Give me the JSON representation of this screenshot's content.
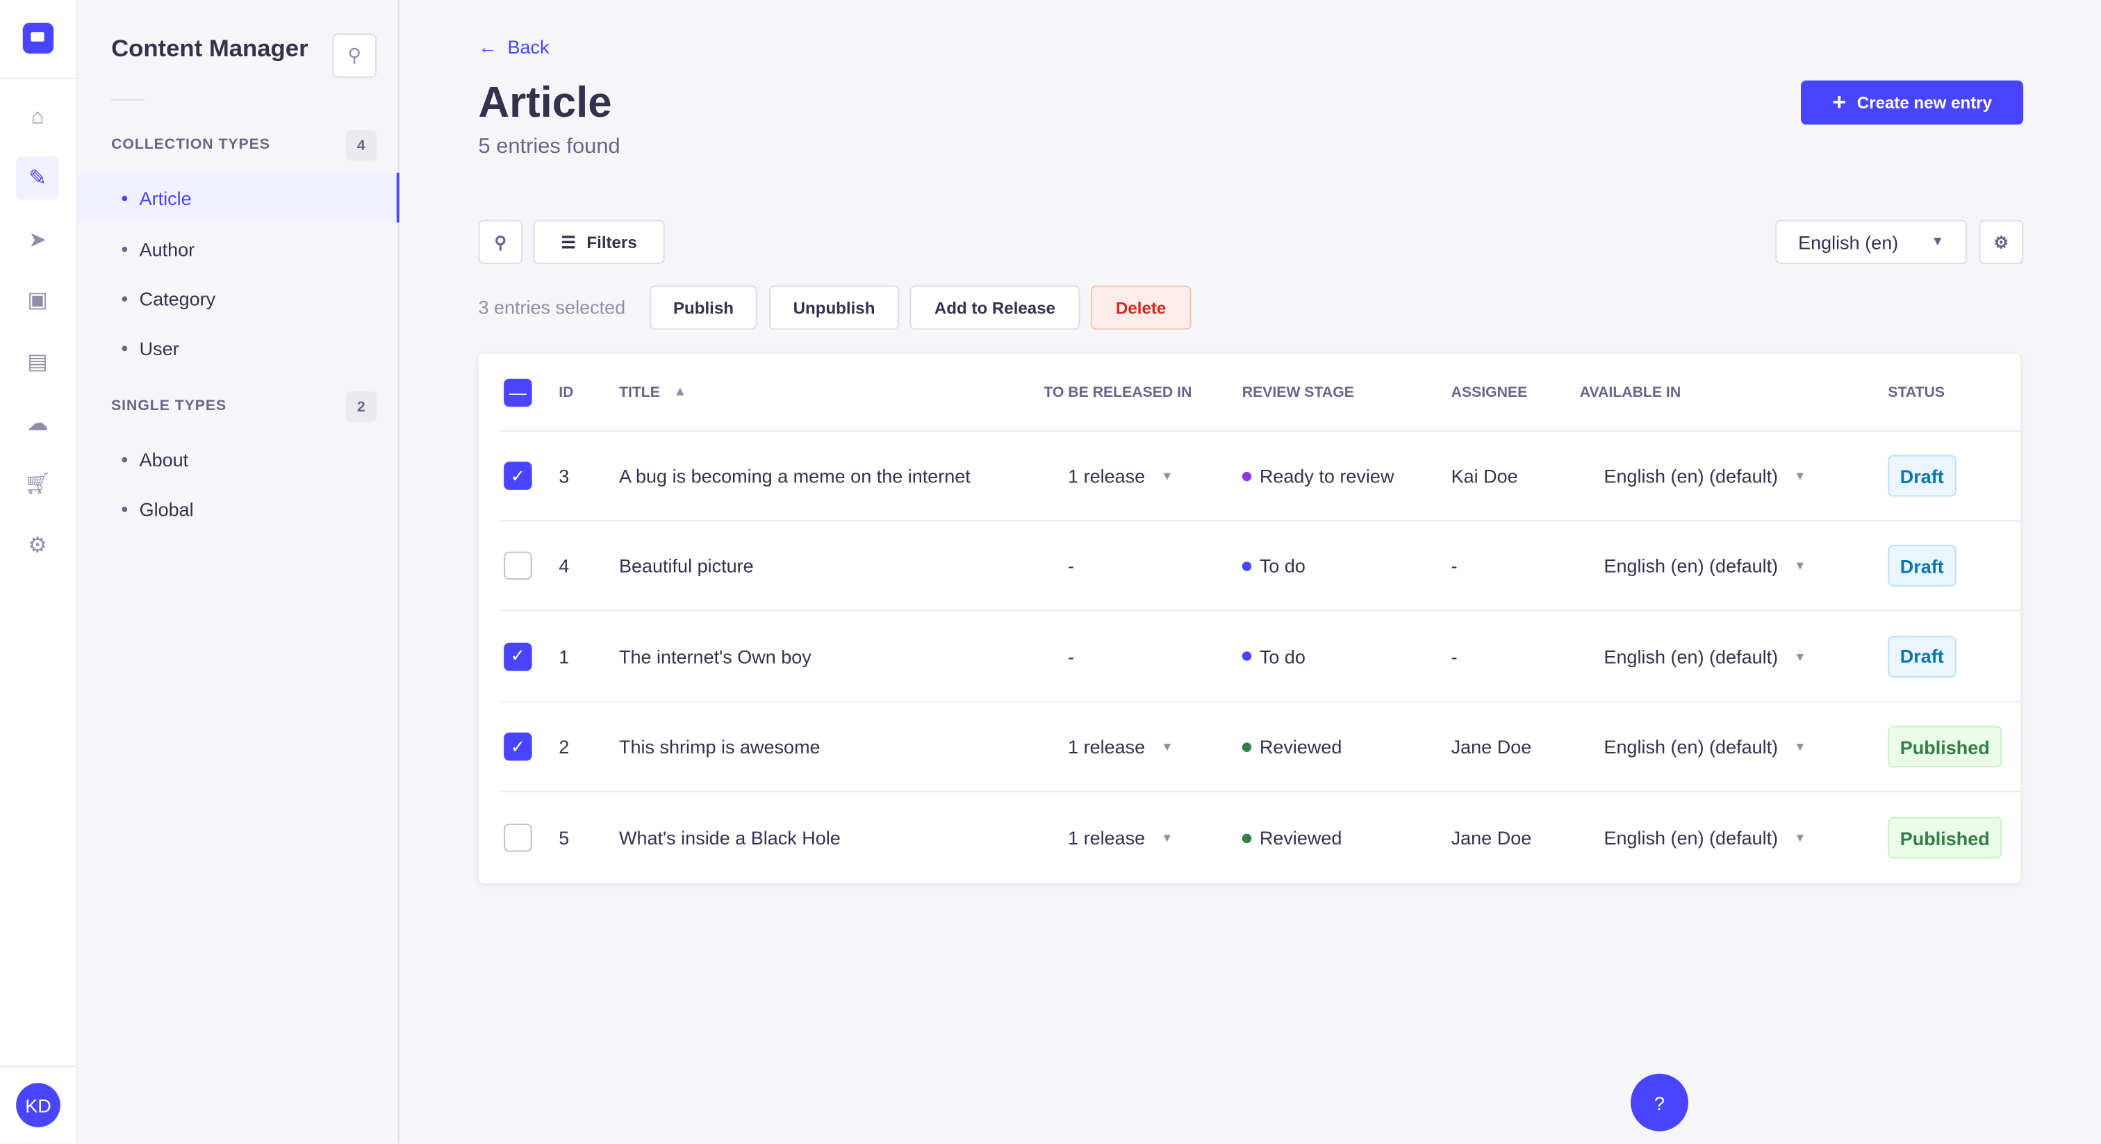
{
  "nav": {
    "avatar": "KD",
    "items": [
      "home-icon",
      "content-manager-icon",
      "releases-icon",
      "media-library-icon",
      "content-type-builder-icon",
      "cloud-icon",
      "marketplace-icon",
      "settings-icon"
    ]
  },
  "sidebar": {
    "title": "Content Manager",
    "collection_label": "COLLECTION TYPES",
    "collection_count": "4",
    "collection_items": [
      "Article",
      "Author",
      "Category",
      "User"
    ],
    "single_label": "SINGLE TYPES",
    "single_count": "2",
    "single_items": [
      "About",
      "Global"
    ]
  },
  "header": {
    "back": "Back",
    "title": "Article",
    "subtitle": "5 entries found",
    "create": "Create new entry"
  },
  "toolbar": {
    "filters": "Filters",
    "locale": "English (en)"
  },
  "bulk": {
    "selected": "3 entries selected",
    "publish": "Publish",
    "unpublish": "Unpublish",
    "add_release": "Add to Release",
    "delete": "Delete"
  },
  "table": {
    "headers": {
      "id": "ID",
      "title": "TITLE",
      "release": "TO BE RELEASED IN",
      "review": "REVIEW STAGE",
      "assignee": "ASSIGNEE",
      "available": "AVAILABLE IN",
      "status": "STATUS"
    },
    "rows": [
      {
        "checked": true,
        "id": "3",
        "title": "A bug is becoming a meme on the internet",
        "release": "1 release",
        "review": "Ready to review",
        "review_color": "#9736e8",
        "assignee": "Kai Doe",
        "available": "English (en) (default)",
        "status": "Draft"
      },
      {
        "checked": false,
        "id": "4",
        "title": "Beautiful picture",
        "release": "-",
        "review": "To do",
        "review_color": "#4945ff",
        "assignee": "-",
        "available": "English (en) (default)",
        "status": "Draft"
      },
      {
        "checked": true,
        "id": "1",
        "title": "The internet's Own boy",
        "release": "-",
        "review": "To do",
        "review_color": "#4945ff",
        "assignee": "-",
        "available": "English (en) (default)",
        "status": "Draft"
      },
      {
        "checked": true,
        "id": "2",
        "title": "This shrimp is awesome",
        "release": "1 release",
        "review": "Reviewed",
        "review_color": "#328048",
        "assignee": "Jane Doe",
        "available": "English (en) (default)",
        "status": "Published"
      },
      {
        "checked": false,
        "id": "5",
        "title": "What's inside a Black Hole",
        "release": "1 release",
        "review": "Reviewed",
        "review_color": "#328048",
        "assignee": "Jane Doe",
        "available": "English (en) (default)",
        "status": "Published"
      }
    ]
  },
  "colors": {
    "primary": "#4945ff",
    "draft_bg": "#eaf5ff",
    "draft_text": "#0c75af",
    "published_bg": "#eafbe7",
    "published_text": "#328048"
  }
}
